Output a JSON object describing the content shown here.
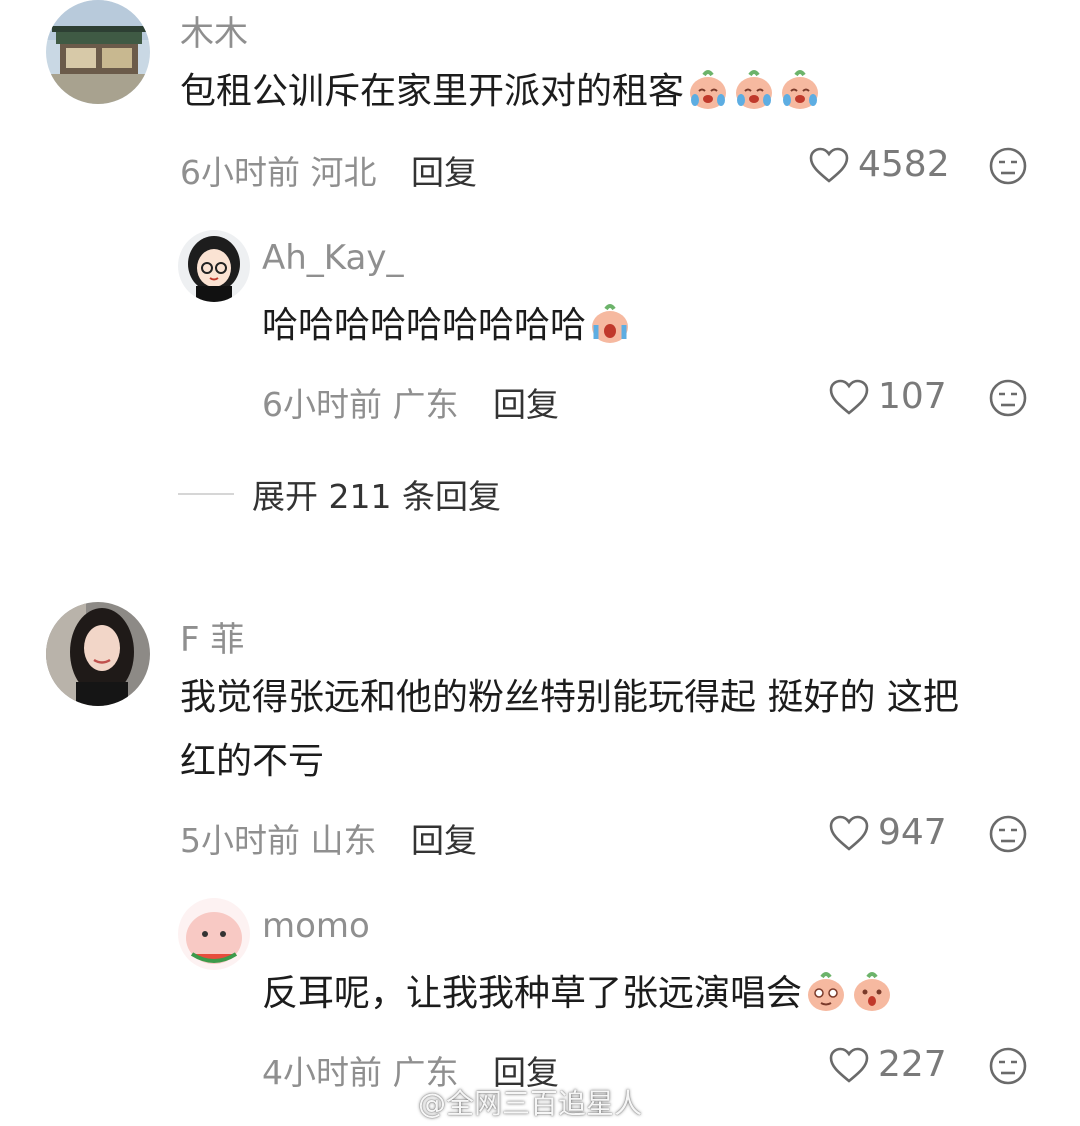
{
  "comments": [
    {
      "username": "木木",
      "text": "包租公训斥在家里开派对的租客",
      "emoji_icons": [
        "crying-laugh-peach-emoji",
        "crying-laugh-peach-emoji",
        "crying-laugh-peach-emoji"
      ],
      "time": "6小时前",
      "location": "河北",
      "reply_label": "回复",
      "likes": "4582"
    },
    {
      "username": "Ah_Kay_",
      "text": "哈哈哈哈哈哈哈哈哈",
      "emoji_icons": [
        "tears-peach-emoji"
      ],
      "time": "6小时前",
      "location": "广东",
      "reply_label": "回复",
      "likes": "107"
    },
    {
      "username": "F 菲",
      "text_line1": "我觉得张远和他的粉丝特别能玩得起 挺好的 这把",
      "text_line2": "红的不亏",
      "time": "5小时前",
      "location": "山东",
      "reply_label": "回复",
      "likes": "947"
    },
    {
      "username": "momo",
      "text": "反耳呢，让我我种草了张远演唱会",
      "emoji_icons": [
        "shy-peach-emoji",
        "shocked-peach-emoji"
      ],
      "time": "4小时前",
      "location": "广东",
      "reply_label": "回复",
      "likes": "227"
    }
  ],
  "expand_replies": "展开 211 条回复",
  "watermark": "@全网三百追星人",
  "colors": {
    "meta": "#8f8f8f",
    "text": "#1c1c1c",
    "background": "#ffffff"
  },
  "icons": {
    "like": "heart-outline-icon",
    "dislike": "meh-face-icon"
  }
}
